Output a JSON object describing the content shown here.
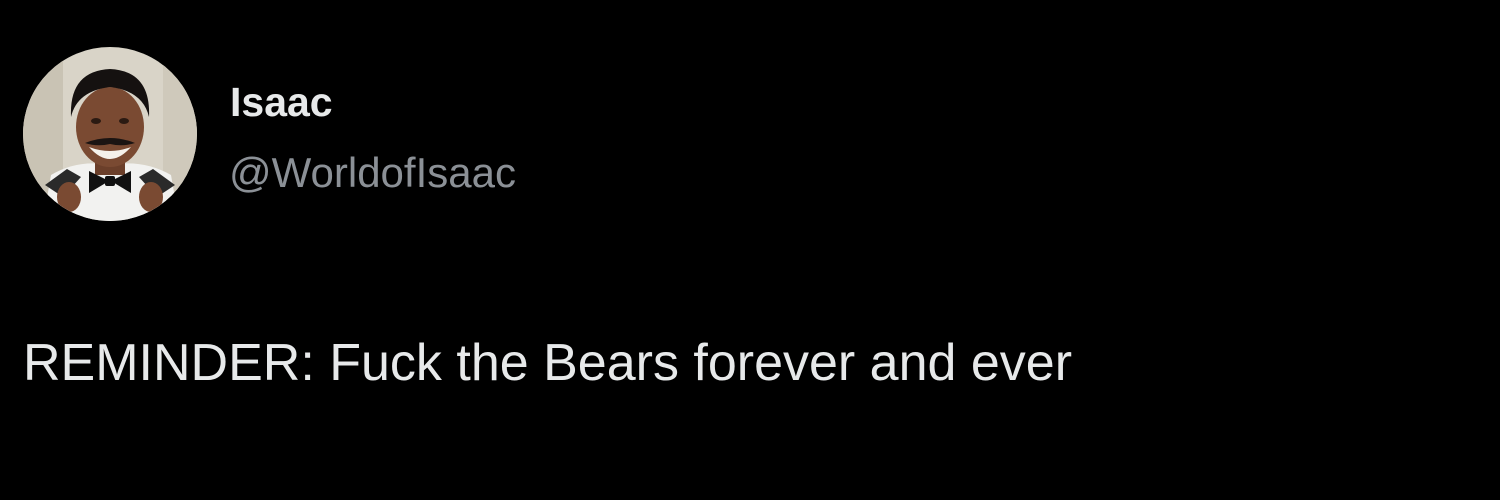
{
  "tweet": {
    "author": {
      "display_name": "Isaac",
      "handle": "@WorldofIsaac",
      "avatar": "profile-photo-avatar"
    },
    "text": "REMINDER: Fuck the Bears forever and ever"
  },
  "colors": {
    "background": "#000000",
    "primary_text": "#e7e9ea",
    "secondary_text": "#8b9096"
  }
}
